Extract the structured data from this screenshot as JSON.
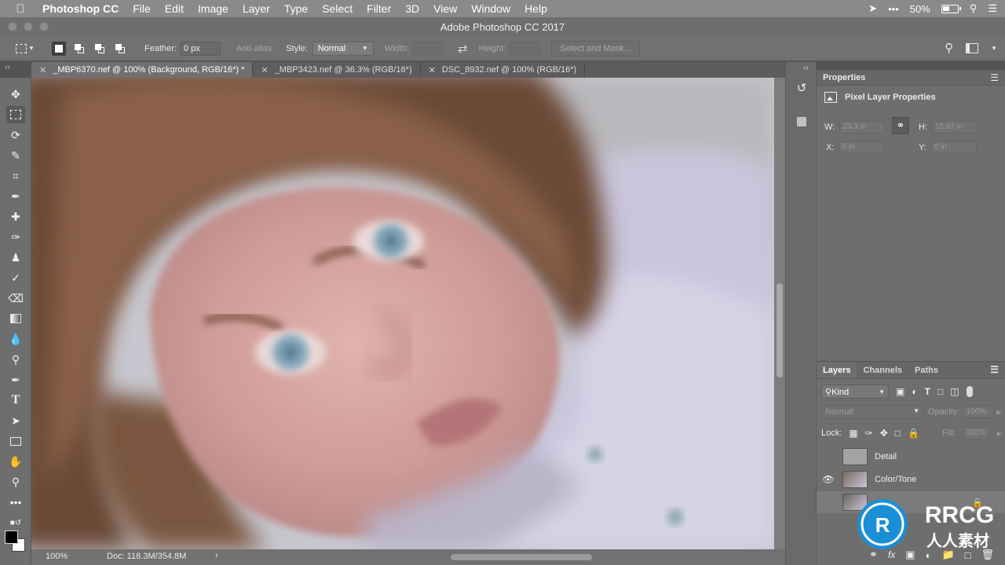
{
  "menubar": {
    "app": "Photoshop CC",
    "items": [
      "File",
      "Edit",
      "Image",
      "Layer",
      "Type",
      "Select",
      "Filter",
      "3D",
      "View",
      "Window",
      "Help"
    ],
    "battery": "50%"
  },
  "window": {
    "title": "Adobe Photoshop CC 2017"
  },
  "options": {
    "feather_label": "Feather:",
    "feather_value": "0 px",
    "anti_alias": "Anti-alias",
    "style_label": "Style:",
    "style_value": "Normal",
    "width_label": "Width:",
    "height_label": "Height:",
    "mask_button": "Select and Mask..."
  },
  "tabs": [
    {
      "label": "_MBP6370.nef @ 100% (Background, RGB/16*) *"
    },
    {
      "label": "_MBP3423.nef @ 36.3% (RGB/16*)"
    },
    {
      "label": "DSC_8932.nef @ 100% (RGB/16*)"
    }
  ],
  "status": {
    "zoom": "100%",
    "doc": "Doc: 118.3M/354.8M"
  },
  "properties": {
    "tab": "Properties",
    "heading": "Pixel Layer Properties",
    "w_label": "W:",
    "w_value": "23.3 in",
    "h_label": "H:",
    "h_value": "15.97 in",
    "x_label": "X:",
    "x_value": "0 in",
    "y_label": "Y:",
    "y_value": "0 in"
  },
  "layers_panel": {
    "tabs": [
      "Layers",
      "Channels",
      "Paths"
    ],
    "filter": "Kind",
    "blend": "Normal",
    "opacity_label": "Opacity:",
    "opacity_value": "100%",
    "lock_label": "Lock:",
    "fill_label": "Fill:",
    "fill_value": "100%",
    "layers": [
      {
        "name": "Detail",
        "visible": false
      },
      {
        "name": "Color/Tone",
        "visible": true
      },
      {
        "name": "",
        "visible": false
      }
    ]
  },
  "watermark": {
    "text": "RRCG",
    "subtext": "人人素材"
  },
  "colors": {
    "menubar": "#8a8a8a",
    "panel": "#6e6e6e",
    "foreground": "#000000",
    "background": "#ffffff",
    "logo_blue": "#1a8fd6"
  }
}
